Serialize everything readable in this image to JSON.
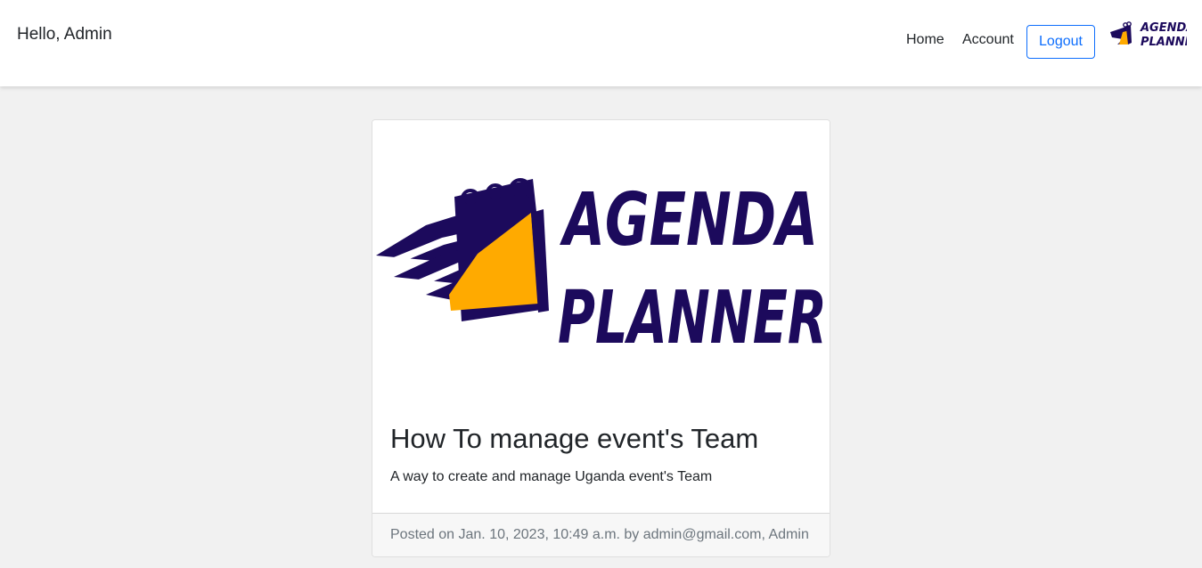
{
  "header": {
    "greeting": "Hello, Admin",
    "nav": {
      "home": "Home",
      "account": "Account",
      "logout": "Logout"
    },
    "logo": {
      "line1": "AGENDA",
      "line2": "PLANNER"
    }
  },
  "post": {
    "image_logo": {
      "line1": "AGENDA",
      "line2": "PLANNER"
    },
    "title": "How To manage event's Team",
    "description": "A way to create and manage Uganda event's Team",
    "footer": "Posted on Jan. 10, 2023, 10:49 a.m. by admin@gmail.com, Admin"
  },
  "colors": {
    "brand_navy": "#1c0a5c",
    "brand_orange": "#ffaa00",
    "primary": "#0d6efd",
    "background": "#f1f1f1"
  }
}
